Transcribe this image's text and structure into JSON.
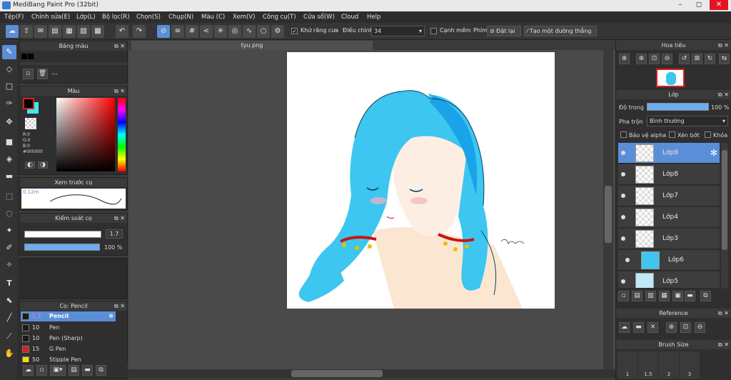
{
  "window": {
    "title": "MediBang Paint Pro (32bit)",
    "min": "–",
    "max": "◻",
    "close": "✕"
  },
  "menu": [
    "Tệp(F)",
    "Chỉnh sửa(E)",
    "Lớp(L)",
    "Bộ lọc(R)",
    "Chọn(S)",
    "Chụp(N)",
    "Màu (C)",
    "Xem(V)",
    "Công cụ(T)",
    "Cửa sổ(W)",
    "Cloud",
    "Help"
  ],
  "toolbar": {
    "antialias": "Khử răng cưa",
    "adjust_label": "Điều chỉnh",
    "adjust_value": "34",
    "smooth": "Cạnh mềm",
    "reset_prefix": "Phím",
    "reset": "Đặt lại",
    "ruler": "Tạo một đường thẳng"
  },
  "panels": {
    "palette": {
      "title": "Bảng màu",
      "info": "---"
    },
    "color": {
      "title": "Màu",
      "r": "R:0",
      "g": "G:0",
      "b": "B:0",
      "hex": "#000000"
    },
    "preview": {
      "title": "Xem trước cọ",
      "size": "0.12m"
    },
    "brush_ctrl": {
      "title": "Kiểm soát cọ",
      "size": "1.7",
      "opacity": "100 %"
    },
    "brush": {
      "title": "Cọ: Pencil",
      "items": [
        {
          "size": "1.7",
          "name": "Pencil",
          "color": "#1a1a1a"
        },
        {
          "size": "10",
          "name": "Pen",
          "color": "#1a1a1a"
        },
        {
          "size": "10",
          "name": "Pen (Sharp)",
          "color": "#1a1a1a"
        },
        {
          "size": "15",
          "name": "G Pen",
          "color": "#d81e1e"
        },
        {
          "size": "50",
          "name": "Stipple Pen",
          "color": "#f0e000"
        }
      ]
    }
  },
  "document": {
    "tab": "tyu.png"
  },
  "navigator": {
    "title": "Hoa tiêu"
  },
  "layer": {
    "title": "Lớp",
    "opacity_label": "Độ trong",
    "opacity_value": "100 %",
    "blend_label": "Pha trộn",
    "blend_value": "Bình thường",
    "protect_alpha": "Bảo vệ alpha",
    "clipping": "Xén bớt",
    "lock": "Khóa",
    "items": [
      {
        "name": "Lớp9"
      },
      {
        "name": "Lớp8"
      },
      {
        "name": "Lớp7"
      },
      {
        "name": "Lớp4"
      },
      {
        "name": "Lớp3"
      },
      {
        "name": "Lớp6"
      },
      {
        "name": "Lớp5"
      }
    ]
  },
  "reference": {
    "title": "Reference"
  },
  "brush_size": {
    "title": "Brush Size",
    "values": [
      "1",
      "1.5",
      "2",
      "3"
    ]
  }
}
